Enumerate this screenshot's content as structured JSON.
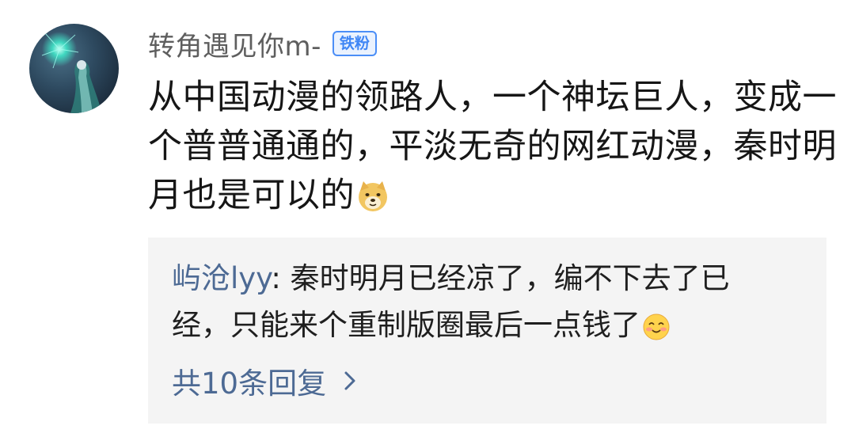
{
  "comment": {
    "username": "转角遇见你m-",
    "badge": "铁粉",
    "text": "从中国动漫的领路人，一个神坛巨人，变成一个普普通通的，平淡无奇的网红动漫，秦时明月也是可以的",
    "emoji": "doge-emoji"
  },
  "reply": {
    "author": "屿沧lyy",
    "separator": ": ",
    "text": "秦时明月已经凉了，编不下去了已经，只能来个重制版圈最后一点钱了",
    "emoji": "blush-smile-emoji"
  },
  "more_replies": {
    "label": "共10条回复",
    "icon": "chevron-right-icon"
  },
  "colors": {
    "link_blue": "#4d6a94",
    "badge_blue": "#3f86f5",
    "reply_bg": "#f4f4f4"
  }
}
